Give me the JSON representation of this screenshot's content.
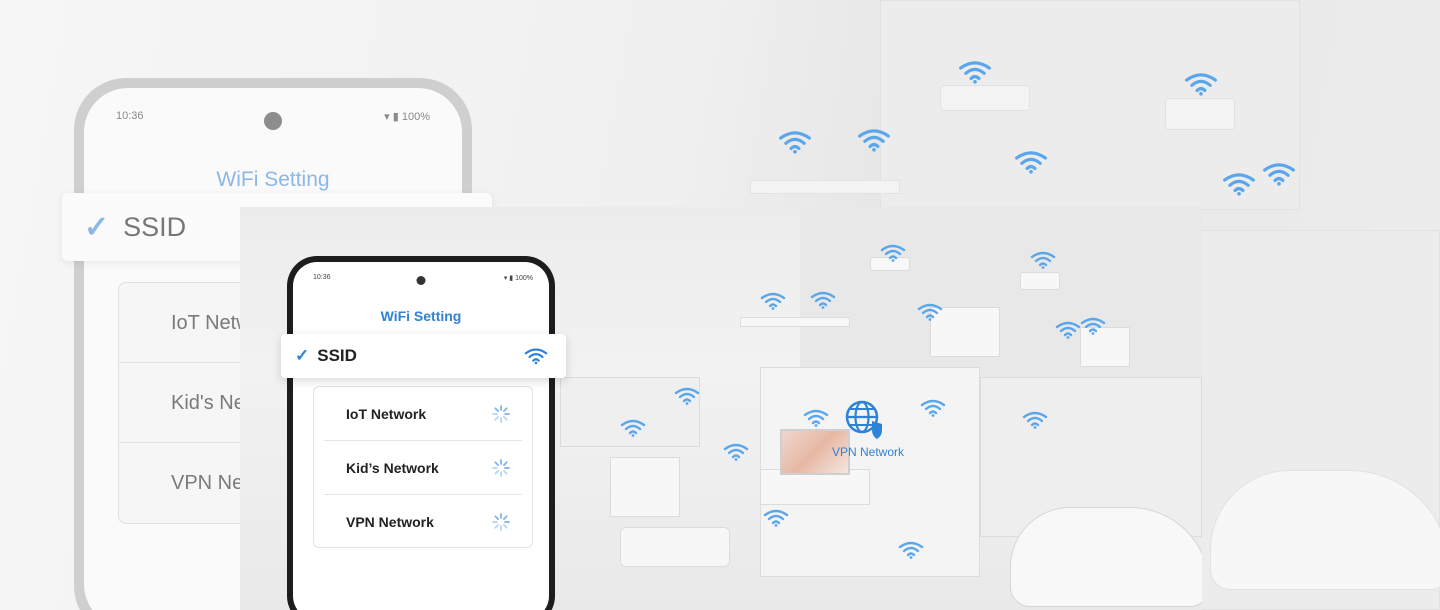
{
  "background_phone": {
    "time": "10:36",
    "battery": "100%",
    "title": "WiFi Setting",
    "ssid_label": "SSID",
    "networks": [
      "IoT Netw",
      "Kid's Ne",
      "VPN Net"
    ]
  },
  "phone": {
    "time": "10:36",
    "battery": "100%",
    "title": "WiFi Setting",
    "ssid_label": "SSID",
    "networks": [
      {
        "label": "IoT Network"
      },
      {
        "label": "Kid’s Network"
      },
      {
        "label": "VPN Network"
      }
    ]
  },
  "illustration": {
    "vpn_label": "VPN Network"
  },
  "colors": {
    "accent": "#2f83d6",
    "accent_light": "#8cb7e6",
    "text": "#222222",
    "muted": "#7a7a7a"
  },
  "icons": {
    "check": "check-icon",
    "wifi": "wifi-icon",
    "spinner": "loading-spinner-icon",
    "globe": "globe-icon",
    "shield": "shield-icon",
    "camera": "front-camera-icon",
    "battery": "battery-icon"
  }
}
